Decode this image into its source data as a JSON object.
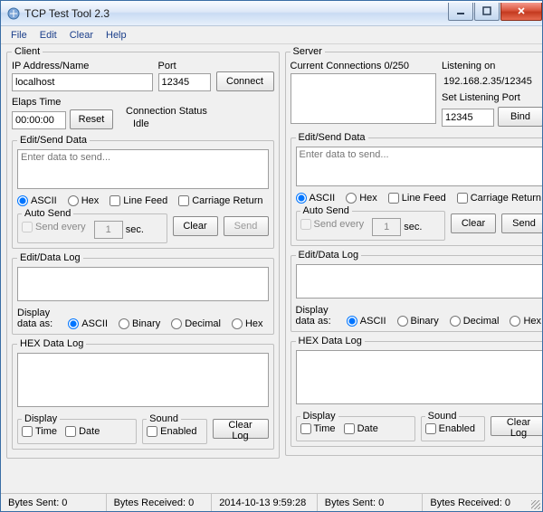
{
  "window": {
    "title": "TCP Test Tool 2.3"
  },
  "menu": {
    "file": "File",
    "edit": "Edit",
    "clear": "Clear",
    "help": "Help"
  },
  "client": {
    "legend": "Client",
    "ip_label": "IP Address/Name",
    "ip_value": "localhost",
    "port_label": "Port",
    "port_value": "12345",
    "connect_btn": "Connect",
    "elaps_label": "Elaps Time",
    "elaps_value": "00:00:00",
    "reset_btn": "Reset",
    "conn_status_label": "Connection Status",
    "conn_status_value": "Idle",
    "edit_send_legend": "Edit/Send Data",
    "send_placeholder": "Enter data to send...",
    "ascii": "ASCII",
    "hex": "Hex",
    "linefeed": "Line Feed",
    "cret": "Carriage Return",
    "autosend_legend": "Auto Send",
    "send_every": "Send every",
    "send_every_val": "1",
    "sec": "sec.",
    "clear_btn": "Clear",
    "send_btn": "Send",
    "editlog_legend": "Edit/Data Log",
    "display_as": "Display data as:",
    "binary": "Binary",
    "decimal": "Decimal",
    "hexlog_legend": "HEX Data Log",
    "display_legend": "Display",
    "time": "Time",
    "date": "Date",
    "sound_legend": "Sound",
    "enabled": "Enabled",
    "clearlog_btn": "Clear Log"
  },
  "server": {
    "legend": "Server",
    "curconn_label": "Current Connections 0/250",
    "listening_label": "Listening on",
    "listening_value": "192.168.2.35/12345",
    "setport_label": "Set Listening Port",
    "setport_value": "12345",
    "bind_btn": "Bind",
    "edit_send_legend": "Edit/Send Data",
    "send_placeholder": "Enter data to send...",
    "ascii": "ASCII",
    "hex": "Hex",
    "linefeed": "Line Feed",
    "cret": "Carriage Return",
    "autosend_legend": "Auto Send",
    "send_every": "Send every",
    "send_every_val": "1",
    "sec": "sec.",
    "clear_btn": "Clear",
    "send_btn": "Send",
    "editlog_legend": "Edit/Data Log",
    "display_as": "Display data as:",
    "binary": "Binary",
    "decimal": "Decimal",
    "hexlog_legend": "HEX Data Log",
    "display_legend": "Display",
    "time": "Time",
    "date": "Date",
    "sound_legend": "Sound",
    "enabled": "Enabled",
    "clearlog_btn": "Clear Log"
  },
  "status": {
    "sent_l": "Bytes Sent: 0",
    "recv_l": "Bytes Received: 0",
    "time": "2014-10-13 9:59:28",
    "sent_r": "Bytes Sent: 0",
    "recv_r": "Bytes Received: 0"
  }
}
